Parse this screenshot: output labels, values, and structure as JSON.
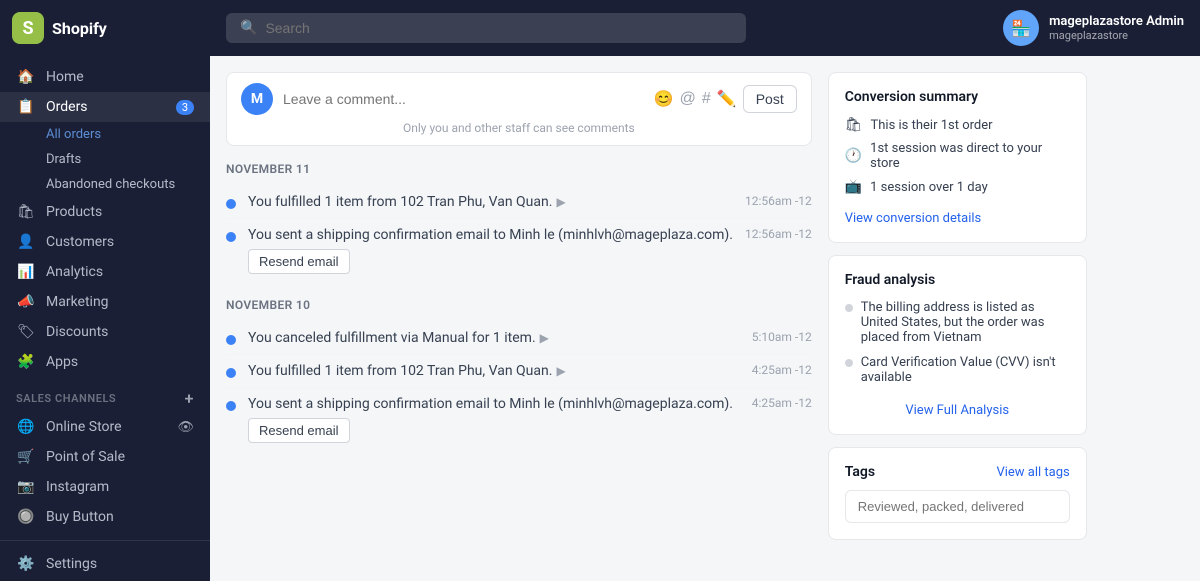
{
  "sidebar": {
    "logo_letter": "S",
    "store_name": "Shopify",
    "nav_items": [
      {
        "id": "home",
        "label": "Home",
        "icon": "🏠",
        "active": false
      },
      {
        "id": "orders",
        "label": "Orders",
        "icon": "📋",
        "badge": "3",
        "active": true
      },
      {
        "id": "products",
        "label": "Products",
        "icon": "🛍",
        "active": false
      },
      {
        "id": "customers",
        "label": "Customers",
        "icon": "👤",
        "active": false
      },
      {
        "id": "analytics",
        "label": "Analytics",
        "icon": "📊",
        "active": false
      },
      {
        "id": "marketing",
        "label": "Marketing",
        "icon": "📣",
        "active": false
      },
      {
        "id": "discounts",
        "label": "Discounts",
        "icon": "🏷",
        "active": false
      },
      {
        "id": "apps",
        "label": "Apps",
        "icon": "🧩",
        "active": false
      }
    ],
    "sub_items": [
      {
        "id": "all-orders",
        "label": "All orders",
        "active": true
      },
      {
        "id": "drafts",
        "label": "Drafts",
        "active": false
      },
      {
        "id": "abandoned",
        "label": "Abandoned checkouts",
        "active": false
      }
    ],
    "sales_channels_label": "SALES CHANNELS",
    "sales_channels": [
      {
        "id": "online-store",
        "label": "Online Store",
        "icon": "🌐",
        "has_eye": true
      },
      {
        "id": "point-of-sale",
        "label": "Point of Sale",
        "icon": "🛒"
      },
      {
        "id": "instagram",
        "label": "Instagram",
        "icon": "📷"
      },
      {
        "id": "buy-button",
        "label": "Buy Button",
        "icon": "🔘"
      }
    ],
    "settings_label": "Settings",
    "settings_icon": "⚙️"
  },
  "topbar": {
    "search_placeholder": "Search",
    "user_name": "mageplazastore Admin",
    "user_store": "mageplazastore"
  },
  "comment_box": {
    "placeholder": "Leave a comment...",
    "post_label": "Post",
    "note": "Only you and other staff can see comments"
  },
  "timeline": [
    {
      "date_label": "NOVEMBER 11",
      "items": [
        {
          "text": "You fulfilled 1 item from 102 Tran Phu, Van Quan.",
          "time": "12:56am -12",
          "has_chevron": true,
          "has_resend": false
        },
        {
          "text": "You sent a shipping confirmation email to Minh le (minhlvh@mageplaza.com).",
          "time": "12:56am -12",
          "has_chevron": false,
          "has_resend": true
        }
      ]
    },
    {
      "date_label": "NOVEMBER 10",
      "items": [
        {
          "text": "You canceled fulfillment via Manual for 1 item.",
          "time": "5:10am -12",
          "has_chevron": true,
          "has_resend": false
        },
        {
          "text": "You fulfilled 1 item from 102 Tran Phu, Van Quan.",
          "time": "4:25am -12",
          "has_chevron": true,
          "has_resend": false
        },
        {
          "text": "You sent a shipping confirmation email to Minh le (minhlvh@mageplaza.com).",
          "time": "4:25am -12",
          "has_chevron": false,
          "has_resend": true
        }
      ]
    }
  ],
  "conversion_summary": {
    "title": "Conversion summary",
    "items": [
      {
        "icon": "🛍",
        "text": "This is their 1st order"
      },
      {
        "icon": "🕐",
        "text": "1st session was direct to your store"
      },
      {
        "icon": "📺",
        "text": "1 session over 1 day"
      }
    ],
    "view_link": "View conversion details"
  },
  "fraud_analysis": {
    "title": "Fraud analysis",
    "items": [
      {
        "text": "The billing address is listed as United States, but the order was placed from Vietnam"
      },
      {
        "text": "Card Verification Value (CVV) isn't available"
      }
    ],
    "view_link": "View Full Analysis"
  },
  "tags": {
    "title": "Tags",
    "view_all_link": "View all tags",
    "placeholder": "Reviewed, packed, delivered"
  }
}
